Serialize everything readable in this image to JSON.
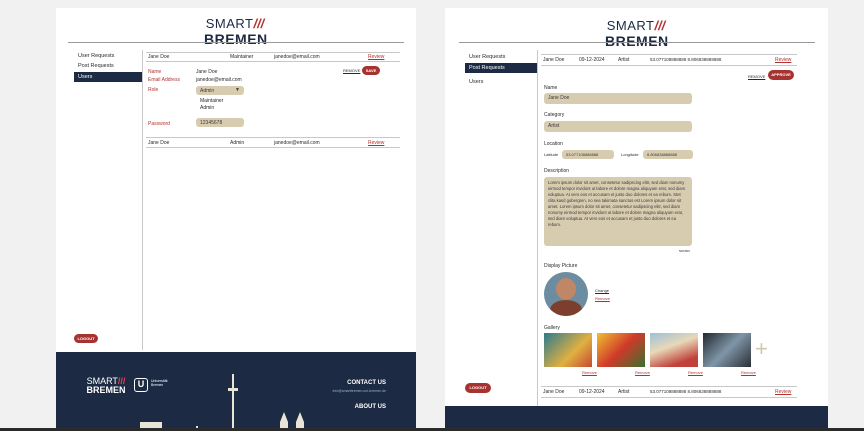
{
  "brand": {
    "smart": "SMART",
    "bremen": "BREMEN"
  },
  "colors": {
    "navy": "#1c2a44",
    "red": "#a63330",
    "beige": "#d8ccb0"
  },
  "left": {
    "sidebar": [
      {
        "label": "User Requests"
      },
      {
        "label": "Post Requests"
      },
      {
        "label": "Users"
      }
    ],
    "rows": [
      {
        "name": "Jane Doe",
        "role": "Maintainer",
        "email": "janedoe@email.com",
        "action": "Review"
      },
      {
        "name": "Jane Doe",
        "role": "Admin",
        "email": "janedoe@email.com",
        "action": "Review"
      }
    ],
    "form": {
      "name_label": "Name",
      "name_value": "Jane Doe",
      "email_label": "Email Address",
      "email_value": "janedoe@email.com",
      "role_label": "Role",
      "role_selected": "Admin",
      "role_options": [
        "Maintainer",
        "Admin"
      ],
      "password_label": "Password",
      "password_value": "12345678",
      "remove": "REMOVE",
      "save": "SAVE"
    },
    "logout": "LOGOUT",
    "footer": {
      "uni_name": "Universität Bremen",
      "contact_title": "CONTACT US",
      "contact_email": "info@smartbremen.uni-bremen.de",
      "about": "ABOUT US"
    }
  },
  "right": {
    "sidebar": [
      {
        "label": "User Requests"
      },
      {
        "label": "Post Requests"
      },
      {
        "label": "Users"
      }
    ],
    "rows": [
      {
        "name": "Jane Doe",
        "date": "09-12-2024",
        "category": "Artist",
        "coords": "53.077108888888 8.806838888888",
        "action": "Review"
      },
      {
        "name": "Jane Doe",
        "date": "09-12-2024",
        "category": "Artist",
        "coords": "53.077108888888 8.806838888888",
        "action": "Review"
      }
    ],
    "remove": "REMOVE",
    "approve": "APPROVE",
    "form": {
      "name_label": "Name",
      "name_value": "Jane Doe",
      "category_label": "Category",
      "category_value": "Artist",
      "location_label": "Location",
      "lat_label": "Latitude",
      "lat_value": "53.077108888888",
      "lon_label": "Longitude",
      "lon_value": "8.806838888888",
      "description_label": "Description",
      "description": "Lorem ipsum dolor sit amet, consetetur sadipscing elitr, sed diam nonumy eirmod tempor invidunt ut labore et dolore magna aliquyam erat, sed diam voluptua. At vero eos et accusam et justo duo dolores et ea rebum. Stet clita kasd gubergren, no sea takimata sanctus est Lorem ipsum dolor sit amet. Lorem ipsum dolor sit amet, consetetur sadipscing elitr, sed diam nonumy eirmod tempor invidunt ut labore et dolore magna aliquyam erat, sed diam voluptua. At vero eos et accusam et justo duo dolores et ea rebum.",
      "counter": "500/500",
      "display_label": "Display Picture",
      "change": "Change",
      "remove_pic": "Remove",
      "gallery_label": "Gallery",
      "gallery_remove": [
        "Remove",
        "Remove",
        "Remove",
        "Remove"
      ]
    },
    "logout": "LOGOUT"
  }
}
